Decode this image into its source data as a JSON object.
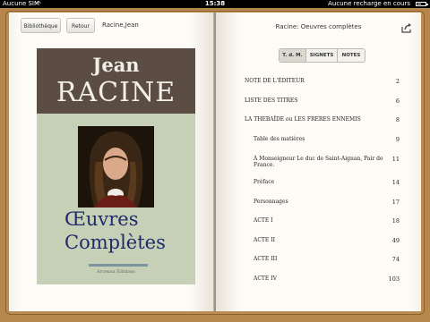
{
  "status_bar": {
    "carrier": "Aucune SIM",
    "time": "15:38",
    "charge_text": "Aucune recharge en cours",
    "battery_level": 0.5
  },
  "toolbar": {
    "library_label": "Bibliothèque",
    "back_label": "Retour",
    "book_header": "Racine,Jean"
  },
  "cover": {
    "first_name": "Jean",
    "last_name": "RACINE",
    "title_line1": "Œuvres",
    "title_line2": "Complètes",
    "publisher": "Arvensa Éditions"
  },
  "right_page": {
    "title": "Racine: Oeuvres complètes",
    "tabs": [
      "T. d. M.",
      "SIGNETS",
      "NOTES"
    ],
    "active_tab": 0
  },
  "toc": [
    {
      "label": "NOTE DE L'ÉDITEUR",
      "page": "2",
      "level": 0
    },
    {
      "label": "LISTE DES TITRES",
      "page": "6",
      "level": 0
    },
    {
      "label": "LA THEBAÏDE ou LES FRERES ENNEMIS",
      "page": "8",
      "level": 0
    },
    {
      "label": "Table des matières",
      "page": "9",
      "level": 1
    },
    {
      "label": "À Monseigneur Le duc de Saint-Aignan, Pair de France.",
      "page": "11",
      "level": 1
    },
    {
      "label": "Préface",
      "page": "14",
      "level": 1
    },
    {
      "label": "Personnages",
      "page": "17",
      "level": 1
    },
    {
      "label": "ACTE I",
      "page": "18",
      "level": 1
    },
    {
      "label": "ACTE II",
      "page": "49",
      "level": 1
    },
    {
      "label": "ACTE III",
      "page": "74",
      "level": 1
    },
    {
      "label": "ACTE IV",
      "page": "103",
      "level": 1
    }
  ]
}
